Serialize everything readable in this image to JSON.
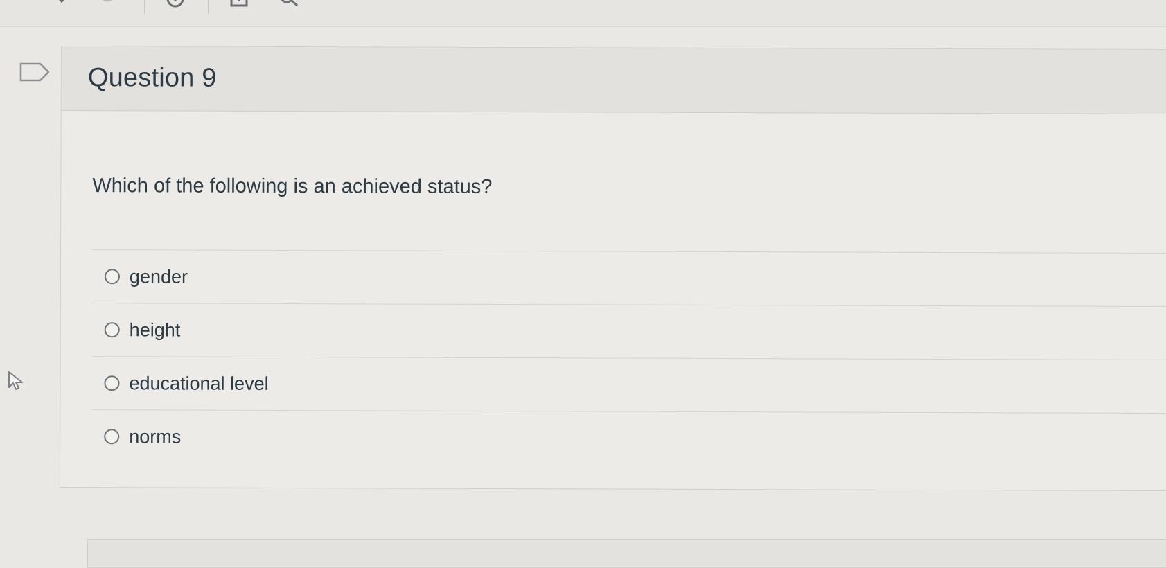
{
  "question": {
    "title": "Question 9",
    "prompt": "Which of the following is an achieved status?",
    "answers": [
      {
        "label": "gender"
      },
      {
        "label": "height"
      },
      {
        "label": "educational level"
      },
      {
        "label": "norms"
      }
    ]
  },
  "icons": {
    "toolbar": [
      "close-icon",
      "undo-icon",
      "info-icon",
      "add-icon",
      "search-icon"
    ],
    "flag": "flag-icon",
    "cursor": "cursor-icon"
  },
  "colors": {
    "background": "#e9e8e4",
    "card": "#ecebe7",
    "header": "#e2e1dd",
    "text": "#2d3b45"
  }
}
